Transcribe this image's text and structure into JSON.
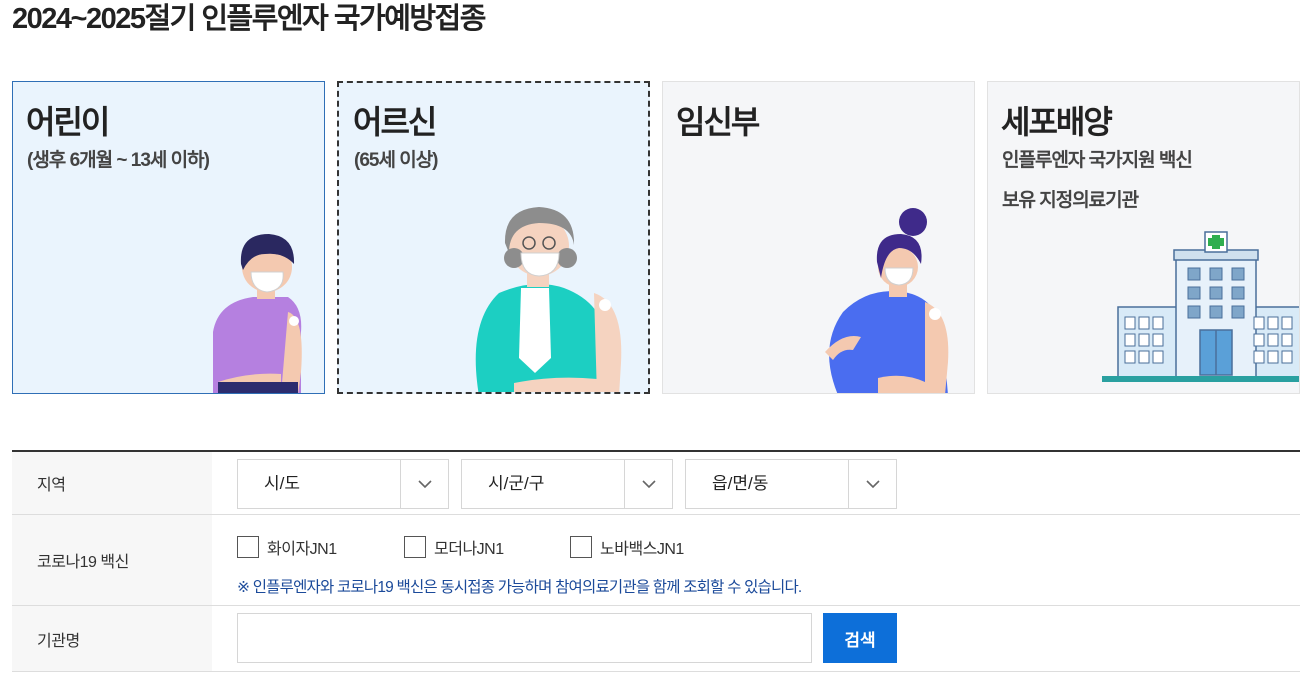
{
  "page": {
    "title": "2024~2025절기 인플루엔자 국가예방접종"
  },
  "cards": [
    {
      "title": "어린이",
      "subtitle": "(생후 6개월 ~ 13세 이하)"
    },
    {
      "title": "어르신",
      "subtitle": "(65세 이상)"
    },
    {
      "title": "임신부"
    },
    {
      "title": "세포배양",
      "subtitle": "인플루엔자 국가지원 백신",
      "subtitle2": "보유 지정의료기관"
    }
  ],
  "form": {
    "region": {
      "label": "지역",
      "selects": [
        "시/도",
        "시/군/구",
        "읍/면/동"
      ]
    },
    "covid": {
      "label": "코로나19 백신",
      "options": [
        "화이자JN1",
        "모더나JN1",
        "노바백스JN1"
      ],
      "note": "※ 인플루엔자와 코로나19 백신은 동시접종 가능하며 참여의료기관을 함께 조회할 수 있습니다."
    },
    "institution": {
      "label": "기관명",
      "input_value": "",
      "search_label": "검색"
    }
  },
  "colors": {
    "accent": "#0d6fd9",
    "note": "#1b4a9a",
    "card_selected": "#eaf4fd"
  },
  "icons": [
    "chevron-down-icon",
    "child-illustration",
    "elderly-illustration",
    "pregnant-illustration",
    "hospital-illustration"
  ]
}
